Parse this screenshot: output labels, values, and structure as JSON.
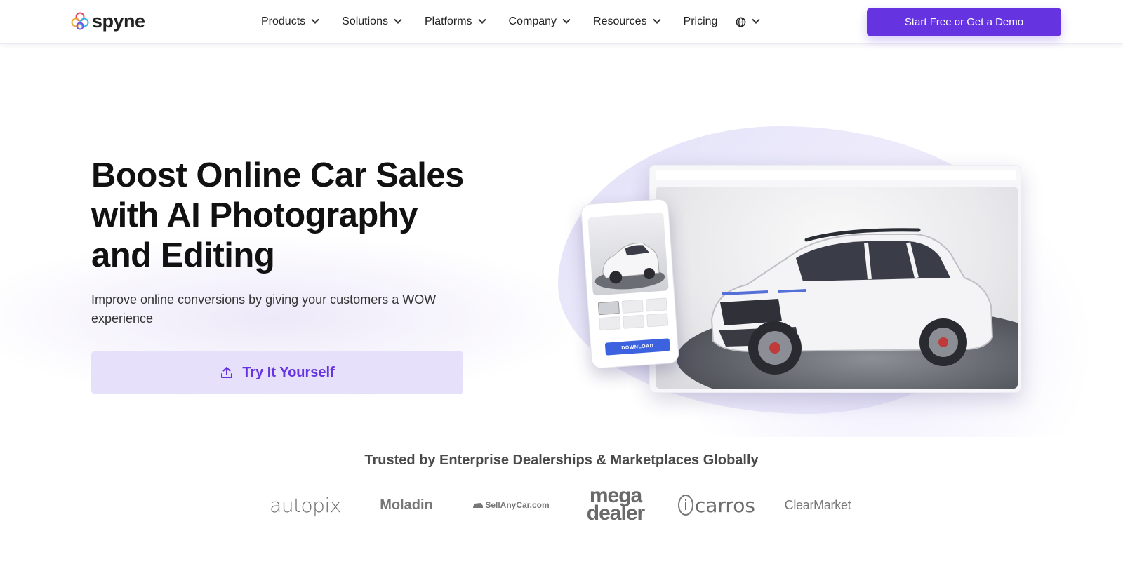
{
  "nav": {
    "logo_text": "spyne",
    "items": [
      {
        "label": "Products"
      },
      {
        "label": "Solutions"
      },
      {
        "label": "Platforms"
      },
      {
        "label": "Company"
      },
      {
        "label": "Resources"
      },
      {
        "label": "Pricing"
      }
    ],
    "language_icon": "globe-icon",
    "cta_label": "Start Free or Get a Demo"
  },
  "hero": {
    "title": "Boost Online Car Sales with AI Photography and Editing",
    "subtitle": "Improve online conversions by giving your customers a WOW experience",
    "try_label": "Try It Yourself",
    "try_icon": "upload-icon",
    "phone_download_label": "DOWNLOAD"
  },
  "trusted": {
    "heading": "Trusted by Enterprise Dealerships & Marketplaces Globally",
    "brands": [
      {
        "name": "autopix"
      },
      {
        "name": "Moladin"
      },
      {
        "name": "SellAnyCar.com"
      },
      {
        "name_line1": "mega",
        "name_line2": "dealer"
      },
      {
        "name": "carros"
      },
      {
        "name": "ClearMarket"
      }
    ]
  },
  "colors": {
    "primary": "#6534e0",
    "try_button_bg": "#e6e0fb",
    "text_dark": "#111111"
  }
}
